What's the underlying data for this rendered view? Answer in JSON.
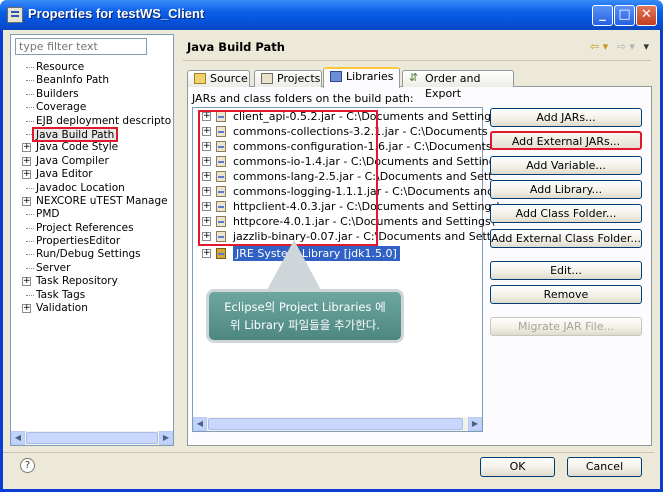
{
  "window": {
    "title": "Properties for testWS_Client"
  },
  "left": {
    "filter_placeholder": "type filter text",
    "items": [
      {
        "label": "Resource",
        "expandable": false
      },
      {
        "label": "BeanInfo Path",
        "expandable": false
      },
      {
        "label": "Builders",
        "expandable": false
      },
      {
        "label": "Coverage",
        "expandable": false
      },
      {
        "label": "EJB deployment descripto",
        "expandable": false
      },
      {
        "label": "Java Build Path",
        "expandable": false,
        "selected": true
      },
      {
        "label": "Java Code Style",
        "expandable": true
      },
      {
        "label": "Java Compiler",
        "expandable": true
      },
      {
        "label": "Java Editor",
        "expandable": true
      },
      {
        "label": "Javadoc Location",
        "expandable": false
      },
      {
        "label": "NEXCORE uTEST Manage",
        "expandable": true
      },
      {
        "label": "PMD",
        "expandable": false
      },
      {
        "label": "Project References",
        "expandable": false
      },
      {
        "label": "PropertiesEditor",
        "expandable": false
      },
      {
        "label": "Run/Debug Settings",
        "expandable": false
      },
      {
        "label": "Server",
        "expandable": false
      },
      {
        "label": "Task Repository",
        "expandable": true
      },
      {
        "label": "Task Tags",
        "expandable": false
      },
      {
        "label": "Validation",
        "expandable": true
      }
    ]
  },
  "main": {
    "title": "Java Build Path",
    "tabs": [
      {
        "label": "Source"
      },
      {
        "label": "Projects"
      },
      {
        "label": "Libraries",
        "active": true
      },
      {
        "label": "Order and Export"
      }
    ],
    "jar_label": "JARs and class folders on the build path:",
    "jars": [
      "client_api-0.5.2.jar - C:\\Documents and Settings",
      "commons-collections-3.2.1.jar - C:\\Documents",
      "commons-configuration-1.6.jar - C:\\Documents",
      "commons-io-1.4.jar - C:\\Documents and Setting",
      "commons-lang-2.5.jar - C:\\Documents and Sett",
      "commons-logging-1.1.1.jar - C:\\Documents and",
      "httpclient-4.0.3.jar - C:\\Documents and Settings\\",
      "httpcore-4.0.1.jar - C:\\Documents and Settings\\",
      "jazzlib-binary-0.07.jar - C:\\Documents and Setti"
    ],
    "jre": "JRE System Library [jdk1.5.0]",
    "callout_line1": "Eclipse의 Project Libraries 에",
    "callout_line2": "위 Library 파일들을 추가한다.",
    "buttons": {
      "add_jars": "Add JARs...",
      "add_external_jars": "Add External JARs...",
      "add_variable": "Add Variable...",
      "add_library": "Add Library...",
      "add_class_folder": "Add Class Folder...",
      "add_external_class_folder": "Add External Class Folder...",
      "edit": "Edit...",
      "remove": "Remove",
      "migrate": "Migrate JAR File..."
    }
  },
  "footer": {
    "help": "?",
    "ok": "OK",
    "cancel": "Cancel"
  },
  "icons": {
    "minimize": "minimize-icon",
    "maximize": "maximize-icon",
    "close": "close-icon"
  },
  "colors": {
    "highlight_red": "#e0192e",
    "callout": "#5a948d",
    "selection": "#3161c5"
  }
}
